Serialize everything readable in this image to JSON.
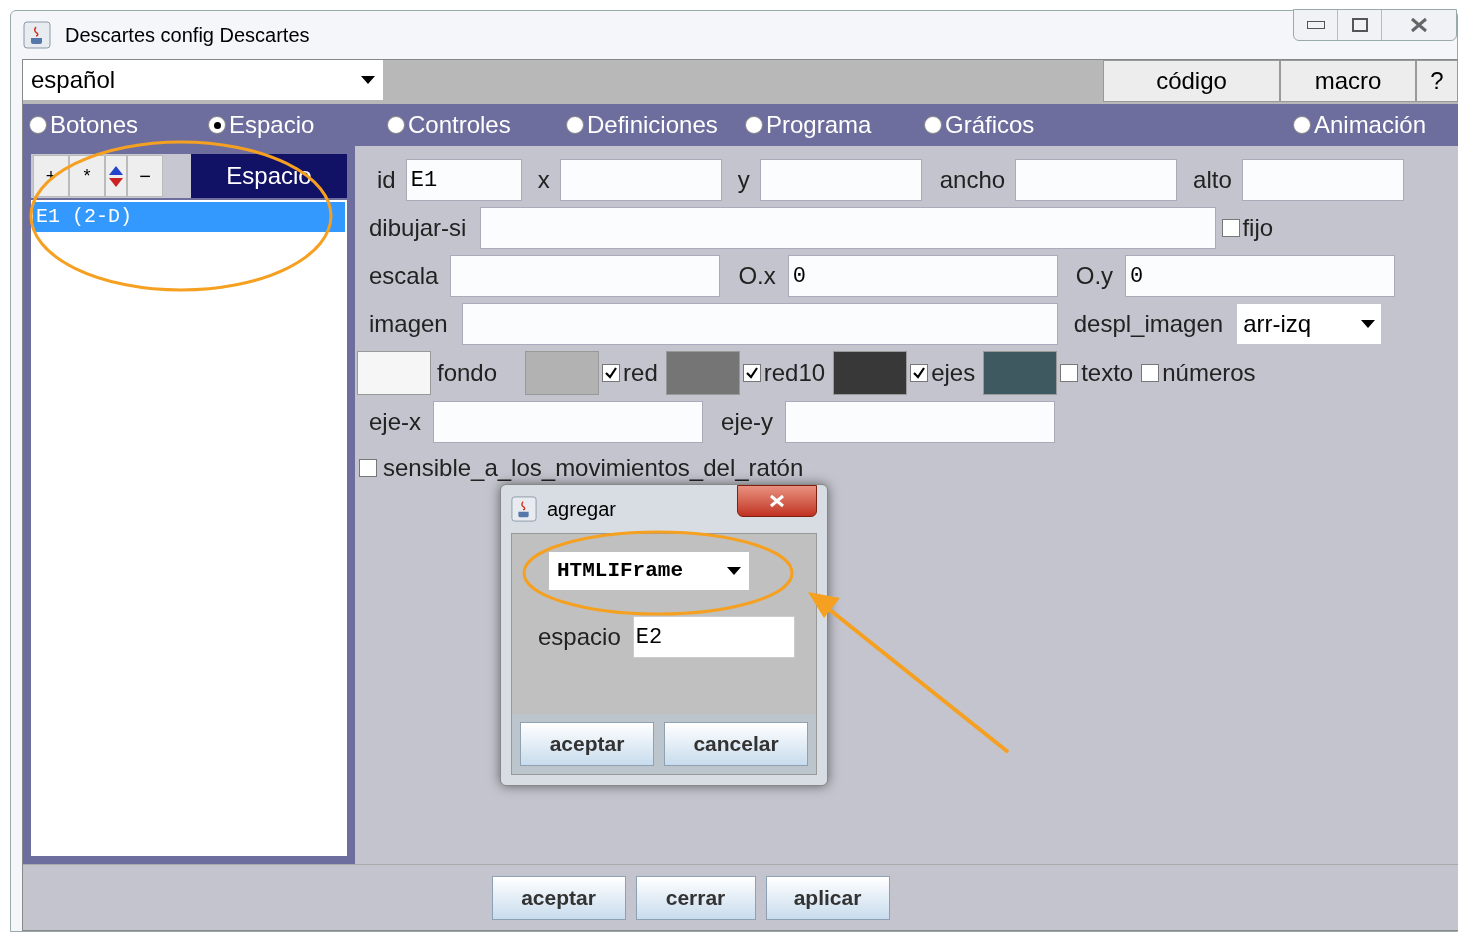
{
  "window": {
    "title": "Descartes config Descartes"
  },
  "language_select": {
    "value": "español"
  },
  "top_buttons": [
    "código",
    "macro",
    "?"
  ],
  "tabs": [
    {
      "label": "Botones",
      "selected": false
    },
    {
      "label": "Espacio",
      "selected": true
    },
    {
      "label": "Controles",
      "selected": false
    },
    {
      "label": "Definiciones",
      "selected": false
    },
    {
      "label": "Programa",
      "selected": false
    },
    {
      "label": "Gráficos",
      "selected": false
    },
    {
      "label": "Animación",
      "selected": false
    }
  ],
  "list_panel": {
    "tools": [
      "+",
      "*",
      "−"
    ],
    "header": "Espacio",
    "items": [
      {
        "label": "E1 (2-D)",
        "selected": true
      }
    ]
  },
  "space_form": {
    "row1": [
      {
        "label": "id",
        "value": "E1"
      },
      {
        "label": "x"
      },
      {
        "label": "y"
      },
      {
        "label": "ancho"
      },
      {
        "label": "alto"
      }
    ],
    "draw_if": {
      "label": "dibujar-si"
    },
    "fixed": {
      "label": "fijo",
      "checked": false
    },
    "row3": [
      {
        "label": "escala"
      },
      {
        "label": "O.x",
        "value": "0"
      },
      {
        "label": "O.y",
        "value": "0"
      }
    ],
    "image": {
      "label": "imagen"
    },
    "image_position": {
      "label": "despl_imagen",
      "value": "arr-izq"
    },
    "colors": [
      {
        "kind": "swatch_label",
        "color": "#f6f6f6",
        "label": "fondo"
      },
      {
        "kind": "swatch_check",
        "color": "#b2b2b2",
        "label": "red",
        "checked": true
      },
      {
        "kind": "swatch_check",
        "color": "#757575",
        "label": "red10",
        "checked": true
      },
      {
        "kind": "swatch_check",
        "color": "#383838",
        "label": "ejes",
        "checked": true
      },
      {
        "kind": "swatch_check",
        "color": "#3e5a60",
        "label": "texto",
        "checked": false
      },
      {
        "kind": "check",
        "label": "números",
        "checked": false
      }
    ],
    "axes": [
      {
        "label": "eje-x"
      },
      {
        "label": "eje-y"
      }
    ],
    "mouse_sensitive": {
      "label": "sensible_a_los_movimientos_del_ratón",
      "checked": false
    }
  },
  "dialog": {
    "title": "agregar",
    "type_select": "HTMLIFrame",
    "field": {
      "label": "espacio",
      "value": "E2"
    },
    "buttons": [
      "aceptar",
      "cancelar"
    ]
  },
  "bottom_buttons": [
    "aceptar",
    "cerrar",
    "aplicar"
  ]
}
